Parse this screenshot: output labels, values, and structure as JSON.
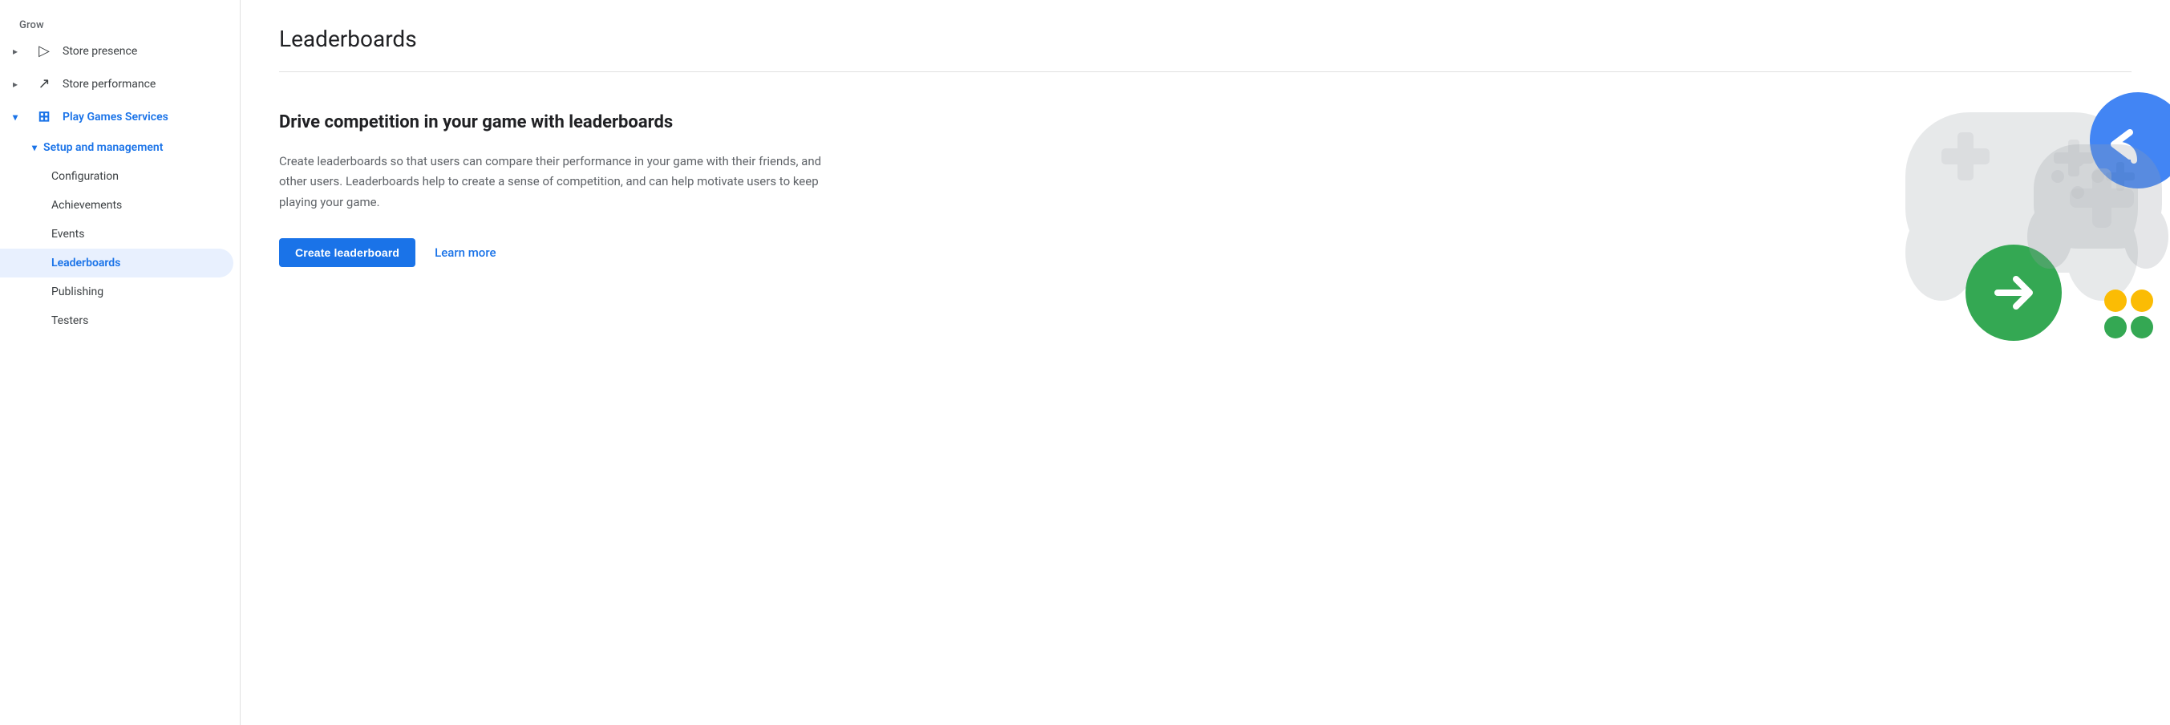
{
  "sidebar": {
    "grow_label": "Grow",
    "items": [
      {
        "id": "store-presence",
        "label": "Store presence",
        "icon": "▷",
        "expand": "▸",
        "active": false,
        "blue": false
      },
      {
        "id": "store-performance",
        "label": "Store performance",
        "icon": "↗",
        "expand": "▸",
        "active": false,
        "blue": false
      },
      {
        "id": "play-games-services",
        "label": "Play Games Services",
        "icon": "⊞",
        "expand": "▾",
        "active": false,
        "blue": true
      }
    ],
    "sub_section": {
      "setup_management_label": "Setup and management",
      "sub_items": [
        {
          "id": "configuration",
          "label": "Configuration",
          "active": false
        },
        {
          "id": "achievements",
          "label": "Achievements",
          "active": false
        },
        {
          "id": "events",
          "label": "Events",
          "active": false
        },
        {
          "id": "leaderboards",
          "label": "Leaderboards",
          "active": true
        },
        {
          "id": "publishing",
          "label": "Publishing",
          "active": false
        },
        {
          "id": "testers",
          "label": "Testers",
          "active": false
        }
      ]
    }
  },
  "main": {
    "page_title": "Leaderboards",
    "content_heading": "Drive competition in your game with leaderboards",
    "content_description": "Create leaderboards so that users can compare their performance in your game with their friends, and other users. Leaderboards help to create a sense of competition, and can help motivate users to keep playing your game.",
    "create_button_label": "Create leaderboard",
    "learn_more_label": "Learn more"
  }
}
